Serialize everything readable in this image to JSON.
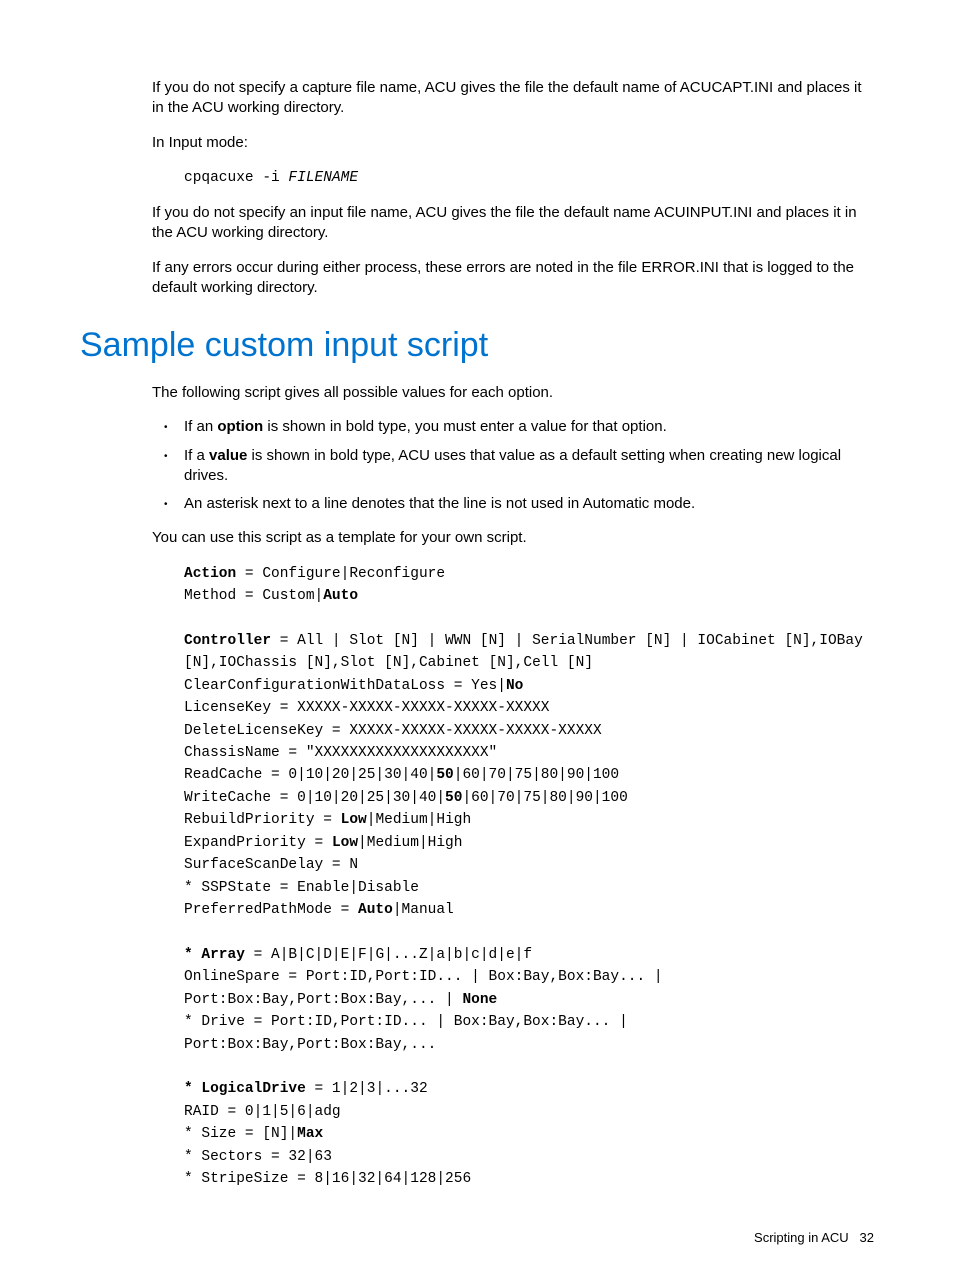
{
  "para1": "If you do not specify a capture file name, ACU gives the file the default name of ACUCAPT.INI and places it in the ACU working directory.",
  "para2": "In Input mode:",
  "code1_a": "cpqacuxe -i ",
  "code1_b": "FILENAME",
  "para3": "If you do not specify an input file name, ACU gives the file the default name ACUINPUT.INI and places it in the ACU working directory.",
  "para4": "If any errors occur during either process, these errors are noted in the file ERROR.INI that is logged to the default working directory.",
  "heading": "Sample custom input script",
  "para5": "The following script gives all possible values for each option.",
  "bullet1_a": "If an ",
  "bullet1_b": "option",
  "bullet1_c": " is shown in bold type, you must enter a value for that option.",
  "bullet2_a": "If a ",
  "bullet2_b": "value",
  "bullet2_c": " is shown in bold type, ACU uses that value as a default setting when creating new logical drives.",
  "bullet3": "An asterisk next to a line denotes that the line is not used in Automatic mode.",
  "para6": "You can use this script as a template for your own script.",
  "s_action_b": "Action",
  "s_action_r": " = Configure|Reconfigure",
  "s_method_a": "Method = Custom|",
  "s_method_b": "Auto",
  "s_ctrl_b": "Controller",
  "s_ctrl_a": " = All | Slot [",
  "s_N": "N",
  "s_ctrl_c": "] | WWN [",
  "s_ctrl_d": "] | SerialNumber [",
  "s_ctrl_e": "] | IOCabinet [",
  "s_ctrl_f": "],IOBay [",
  "s_ctrl_g": "],IOChassis [",
  "s_ctrl_h": "],Slot [",
  "s_ctrl_i": "],Cabinet [",
  "s_ctrl_j": "],Cell [",
  "s_ctrl_k": "]",
  "s_clear_a": "ClearConfigurationWithDataLoss = Yes|",
  "s_clear_b": "No",
  "s_lic": "LicenseKey = XXXXX-XXXXX-XXXXX-XXXXX-XXXXX",
  "s_del": "DeleteLicenseKey = XXXXX-XXXXX-XXXXX-XXXXX-XXXXX",
  "s_chassis": "ChassisName = \"XXXXXXXXXXXXXXXXXXXX\"",
  "s_read_a": "ReadCache = 0|10|20|25|30|40|",
  "s_read_b": "50",
  "s_read_c": "|60|70|75|80|90|100",
  "s_write_a": "WriteCache = 0|10|20|25|30|40|",
  "s_write_b": "50",
  "s_write_c": "|60|70|75|80|90|100",
  "s_rebuild_a": "RebuildPriority = ",
  "s_rebuild_b": "Low",
  "s_rebuild_c": "|Medium|High",
  "s_expand_a": "ExpandPriority = ",
  "s_expand_b": "Low",
  "s_expand_c": "|Medium|High",
  "s_surf_a": "SurfaceScanDelay = ",
  "s_ssp": "* SSPState = Enable|Disable",
  "s_pref_a": "PreferredPathMode = ",
  "s_pref_b": "Auto",
  "s_pref_c": "|Manual",
  "s_arr_a": "* ",
  "s_arr_b": "Array",
  "s_arr_c": " = A|B|C|D|E|F|G|...Z|a|b|c|d|e|f",
  "s_spare_a": "OnlineSpare = Port:ID,Port:ID... | Box:Bay,Box:Bay... | Port:Box:Bay,Port:Box:Bay,... | ",
  "s_spare_b": "None",
  "s_drive": "* Drive = Port:ID,Port:ID... |  Box:Bay,Box:Bay... | Port:Box:Bay,Port:Box:Bay,...",
  "s_ld_a": "* ",
  "s_ld_b": "LogicalDrive",
  "s_ld_c": " = 1|2|3|...32",
  "s_raid": "RAID = 0|1|5|6|adg",
  "s_size_a": "* Size = [",
  "s_size_b": "]|",
  "s_size_c": "Max",
  "s_sect": "* Sectors = 32|63",
  "s_stripe": "* StripeSize = 8|16|32|64|128|256",
  "footer_a": "Scripting in ACU",
  "footer_b": "32"
}
